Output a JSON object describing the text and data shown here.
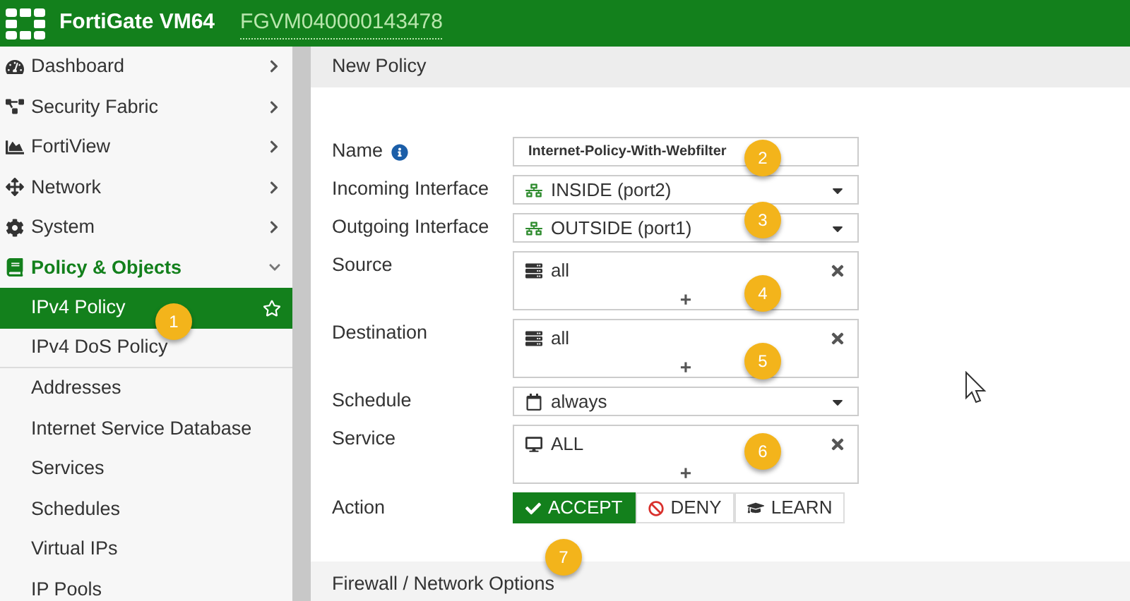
{
  "header": {
    "product": "FortiGate VM64",
    "serial": "FGVM040000143478"
  },
  "sidebar": {
    "items": [
      {
        "label": "Dashboard",
        "expanded": false
      },
      {
        "label": "Security Fabric",
        "expanded": false
      },
      {
        "label": "FortiView",
        "expanded": false
      },
      {
        "label": "Network",
        "expanded": false
      },
      {
        "label": "System",
        "expanded": false
      },
      {
        "label": "Policy & Objects",
        "expanded": true,
        "children": [
          {
            "label": "IPv4 Policy",
            "selected": true
          },
          {
            "label": "IPv4 DoS Policy",
            "selected": false,
            "separator_after": true
          },
          {
            "label": "Addresses",
            "selected": false
          },
          {
            "label": "Internet Service Database",
            "selected": false
          },
          {
            "label": "Services",
            "selected": false
          },
          {
            "label": "Schedules",
            "selected": false
          },
          {
            "label": "Virtual IPs",
            "selected": false
          },
          {
            "label": "IP Pools",
            "selected": false
          }
        ]
      }
    ]
  },
  "page": {
    "title": "New Policy",
    "fields": [
      {
        "label": "Name",
        "kind": "text",
        "value": "Internet-Policy-With-Webfilter"
      },
      {
        "label": "Incoming Interface",
        "kind": "select",
        "value": "INSIDE (port2)"
      },
      {
        "label": "Outgoing Interface",
        "kind": "select",
        "value": "OUTSIDE (port1)"
      },
      {
        "label": "Source",
        "kind": "multi",
        "value": "all",
        "add": "+"
      },
      {
        "label": "Destination",
        "kind": "multi",
        "value": "all",
        "add": "+"
      },
      {
        "label": "Schedule",
        "kind": "select",
        "value": "always"
      },
      {
        "label": "Service",
        "kind": "multi",
        "value": "ALL",
        "add": "+"
      }
    ],
    "action": {
      "label": "Action",
      "options": [
        {
          "label": "ACCEPT",
          "selected": true
        },
        {
          "label": "DENY",
          "selected": false
        },
        {
          "label": "LEARN",
          "selected": false
        }
      ]
    },
    "section": "Firewall / Network Options"
  },
  "callouts": [
    "1",
    "2",
    "3",
    "4",
    "5",
    "6",
    "7"
  ]
}
